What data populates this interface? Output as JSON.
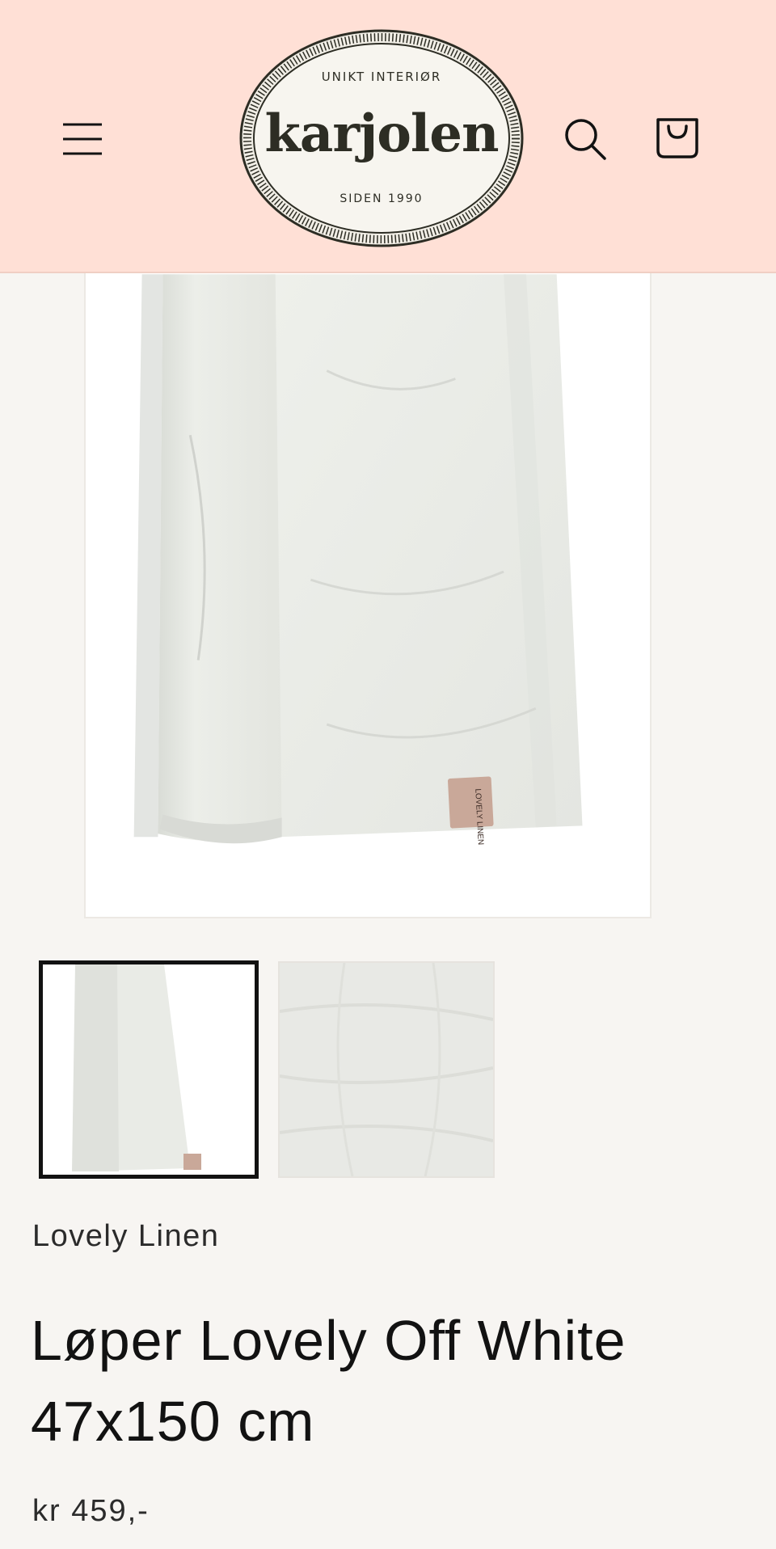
{
  "header": {
    "logo": {
      "top_text": "UNIKT INTERIØR",
      "name": "karjolen",
      "bottom_text": "SIDEN 1990"
    },
    "icons": {
      "menu": "hamburger-menu-icon",
      "search": "search-icon",
      "cart": "shopping-bag-icon"
    },
    "colors": {
      "background": "#ffe0d6",
      "logo_ink": "#2d2d24"
    }
  },
  "product": {
    "vendor": "Lovely Linen",
    "title": "Løper Lovely Off White 47x150 cm",
    "price": "kr 459,-",
    "image_tag_text": "LOVELY LINEN",
    "thumbnails": [
      {
        "label": "folded-runner",
        "selected": true
      },
      {
        "label": "fabric-texture",
        "selected": false
      }
    ]
  },
  "colors": {
    "page_background": "#f7f5f2",
    "text": "#121212",
    "fabric": "#eceee9"
  }
}
